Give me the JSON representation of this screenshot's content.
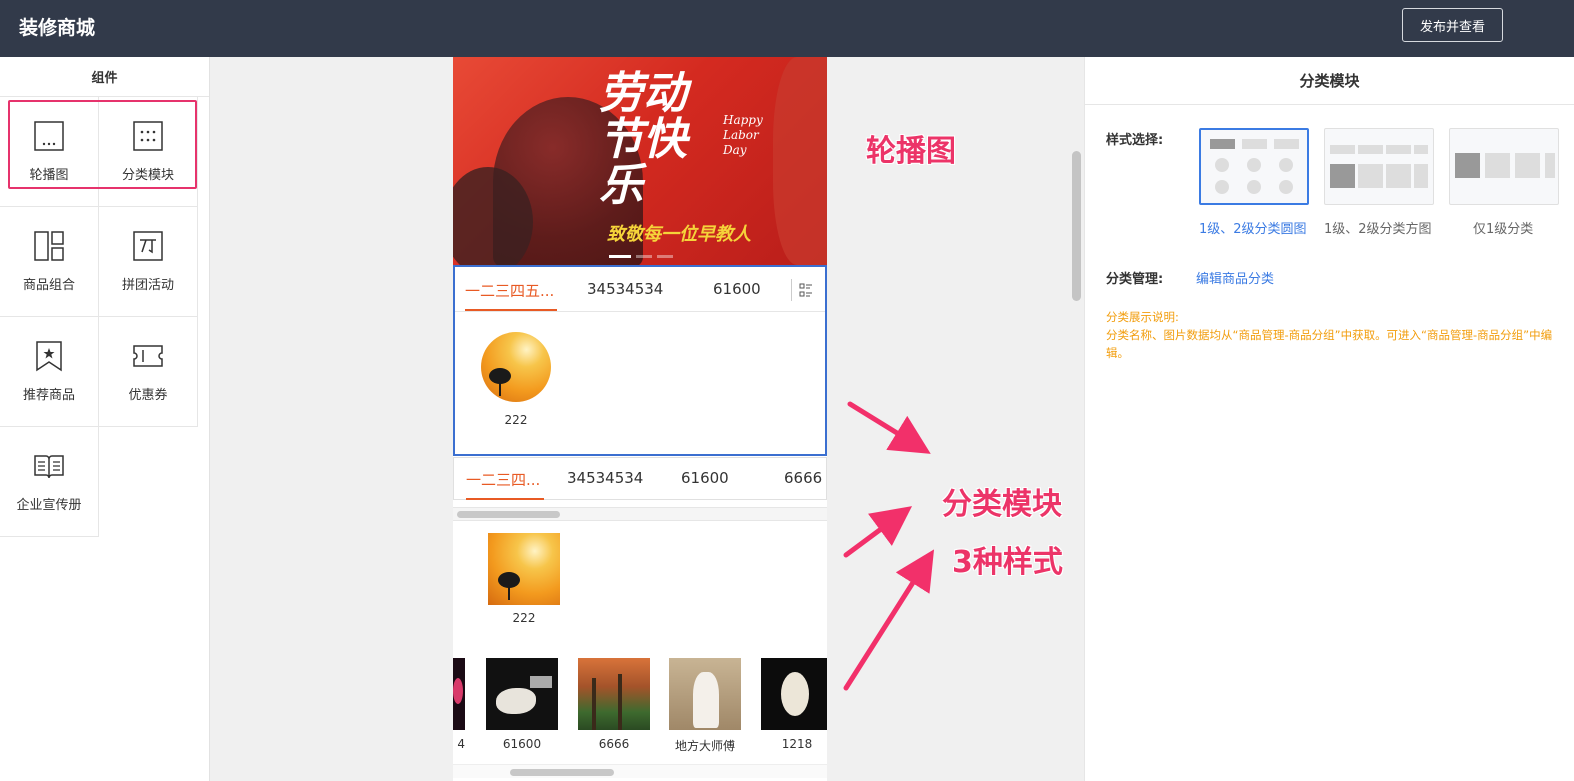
{
  "header": {
    "title": "装修商城",
    "publish_label": "发布并查看"
  },
  "left_panel": {
    "title": "组件",
    "components": [
      {
        "label": "轮播图",
        "icon": "carousel-icon"
      },
      {
        "label": "分类模块",
        "icon": "category-grid-icon"
      },
      {
        "label": "商品组合",
        "icon": "product-combo-icon"
      },
      {
        "label": "拼团活动",
        "icon": "group-buy-icon"
      },
      {
        "label": "推荐商品",
        "icon": "recommend-bookmark-icon"
      },
      {
        "label": "优惠券",
        "icon": "coupon-icon"
      },
      {
        "label": "企业宣传册",
        "icon": "brochure-book-icon"
      }
    ]
  },
  "preview": {
    "banner": {
      "headline": "劳动节快乐",
      "english": "Happy Labor Day",
      "subtitle": "致敬每一位早教人"
    },
    "category_module_1": {
      "tabs": [
        "一二三四五...",
        "34534534",
        "61600"
      ],
      "items": [
        {
          "label": "222"
        }
      ]
    },
    "category_module_2": {
      "tabs": [
        "一二三四...",
        "34534534",
        "61600",
        "6666"
      ],
      "items": [
        {
          "label": "222"
        }
      ],
      "scroll_items": [
        {
          "label": "4"
        },
        {
          "label": "61600"
        },
        {
          "label": "6666"
        },
        {
          "label": "地方大师傅"
        },
        {
          "label": "1218"
        }
      ]
    }
  },
  "annotations": {
    "carousel": "轮播图",
    "category": "分类模块",
    "styles": "3种样式"
  },
  "right_panel": {
    "title": "分类模块",
    "style_label": "样式选择:",
    "styles": [
      {
        "caption": "1级、2级分类圆图",
        "selected": true
      },
      {
        "caption": "1级、2级分类方图",
        "selected": false
      },
      {
        "caption": "仅1级分类",
        "selected": false
      }
    ],
    "manage_label": "分类管理:",
    "manage_link": "编辑商品分类",
    "note_title": "分类展示说明:",
    "note_body": "分类名称、图片数据均从“商品管理-商品分组”中获取。可进入“商品管理-商品分组”中编辑。"
  },
  "colors": {
    "header_bg": "#323a4a",
    "accent_orange": "#e85a24",
    "selection_blue": "#3b6fd0",
    "annotation_pink": "#ec3468",
    "note_orange": "#f29d0c"
  }
}
